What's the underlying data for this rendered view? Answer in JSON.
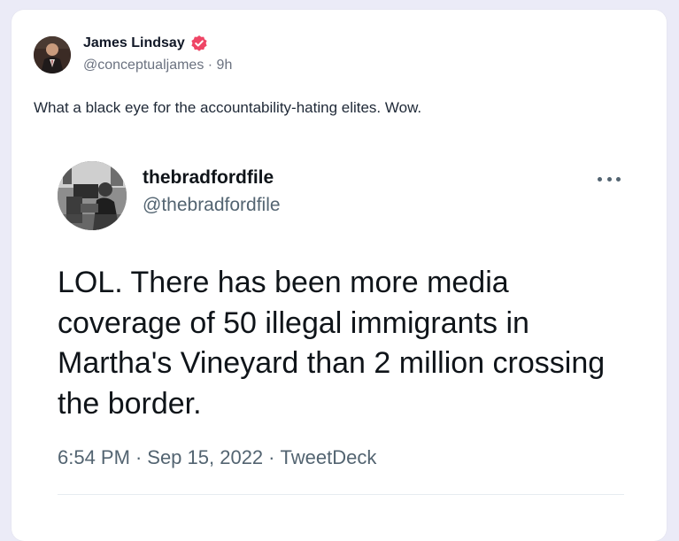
{
  "post": {
    "author_name": "James Lindsay",
    "handle": "@conceptualjames",
    "separator": "·",
    "time_ago": "9h",
    "text": "What a black eye for the accountability-hating elites. Wow.",
    "verified_color": "#ef4666"
  },
  "embedded_tweet": {
    "name": "thebradfordfile",
    "handle": "@thebradfordfile",
    "text": "LOL. There has been more media coverage of 50 illegal immigrants in Martha's Vineyard than 2 million crossing the border.",
    "time": "6:54 PM",
    "date": "Sep 15, 2022",
    "source": "TweetDeck",
    "separator": "·"
  }
}
